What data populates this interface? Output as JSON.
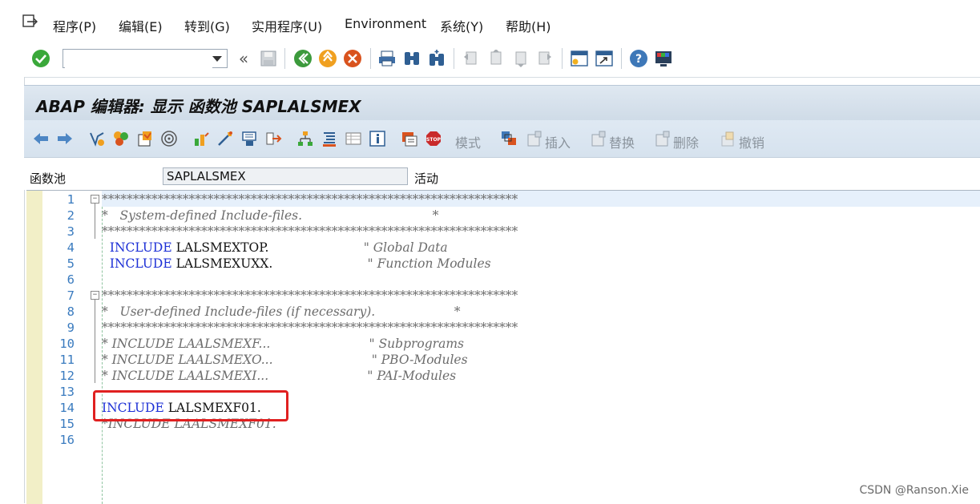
{
  "menubar": {
    "items": [
      "程序(P)",
      "编辑(E)",
      "转到(G)",
      "实用程序(U)",
      "Environment",
      "系统(Y)",
      "帮助(H)"
    ]
  },
  "toolbar": {
    "command_value": "",
    "icons": [
      "enter-icon",
      "command-field",
      "back-double-icon",
      "save-icon",
      "back-icon",
      "exit-icon",
      "cancel-icon",
      "print-icon",
      "find-icon",
      "find-next-icon",
      "first-page-icon",
      "prev-page-icon",
      "next-page-icon",
      "last-page-icon",
      "new-session-icon",
      "shortcut-icon",
      "help-icon",
      "customize-icon"
    ]
  },
  "title": "ABAP 编辑器: 显示 函数池 SAPLALSMEX",
  "toolbar2": {
    "mode_label": "模式",
    "insert_label": "插入",
    "replace_label": "替换",
    "delete_label": "删除",
    "undo_label": "撤销"
  },
  "field": {
    "label": "函数池",
    "value": "SAPLALSMEX",
    "status": "活动"
  },
  "code": {
    "lines": [
      {
        "n": "1",
        "parts": [
          {
            "t": "*******************************************************************",
            "c": "cmt"
          }
        ]
      },
      {
        "n": "2",
        "parts": [
          {
            "t": "*   System-defined Include-files.                                 *",
            "c": "cmt"
          }
        ]
      },
      {
        "n": "3",
        "parts": [
          {
            "t": "*******************************************************************",
            "c": "cmt"
          }
        ]
      },
      {
        "n": "4",
        "parts": [
          {
            "t": "  INCLUDE",
            "c": "kw"
          },
          {
            "t": " LALSMEXTOP.                        ",
            "c": "txt"
          },
          {
            "t": "\" Global Data",
            "c": "cmt"
          }
        ]
      },
      {
        "n": "5",
        "parts": [
          {
            "t": "  INCLUDE",
            "c": "kw"
          },
          {
            "t": " LALSMEXUXX.                        ",
            "c": "txt"
          },
          {
            "t": "\" Function Modules",
            "c": "cmt"
          }
        ]
      },
      {
        "n": "6",
        "parts": []
      },
      {
        "n": "7",
        "parts": [
          {
            "t": "*******************************************************************",
            "c": "cmt"
          }
        ]
      },
      {
        "n": "8",
        "parts": [
          {
            "t": "*   User-defined Include-files (if necessary).                    *",
            "c": "cmt"
          }
        ]
      },
      {
        "n": "9",
        "parts": [
          {
            "t": "*******************************************************************",
            "c": "cmt"
          }
        ]
      },
      {
        "n": "10",
        "parts": [
          {
            "t": "* INCLUDE LAALSMEXF...                         \" Subprograms",
            "c": "cmt"
          }
        ]
      },
      {
        "n": "11",
        "parts": [
          {
            "t": "* INCLUDE LAALSMEXO...                         \" PBO-Modules",
            "c": "cmt"
          }
        ]
      },
      {
        "n": "12",
        "parts": [
          {
            "t": "* INCLUDE LAALSMEXI...                         \" PAI-Modules",
            "c": "cmt"
          }
        ]
      },
      {
        "n": "13",
        "parts": []
      },
      {
        "n": "14",
        "parts": [
          {
            "t": "INCLUDE",
            "c": "kw"
          },
          {
            "t": " LALSMEXF01.",
            "c": "txt"
          }
        ]
      },
      {
        "n": "15",
        "parts": [
          {
            "t": "*INCLUDE LAALSMEXF01.",
            "c": "cmt"
          }
        ]
      },
      {
        "n": "16",
        "parts": []
      }
    ]
  },
  "watermark": "CSDN @Ranson.Xie"
}
